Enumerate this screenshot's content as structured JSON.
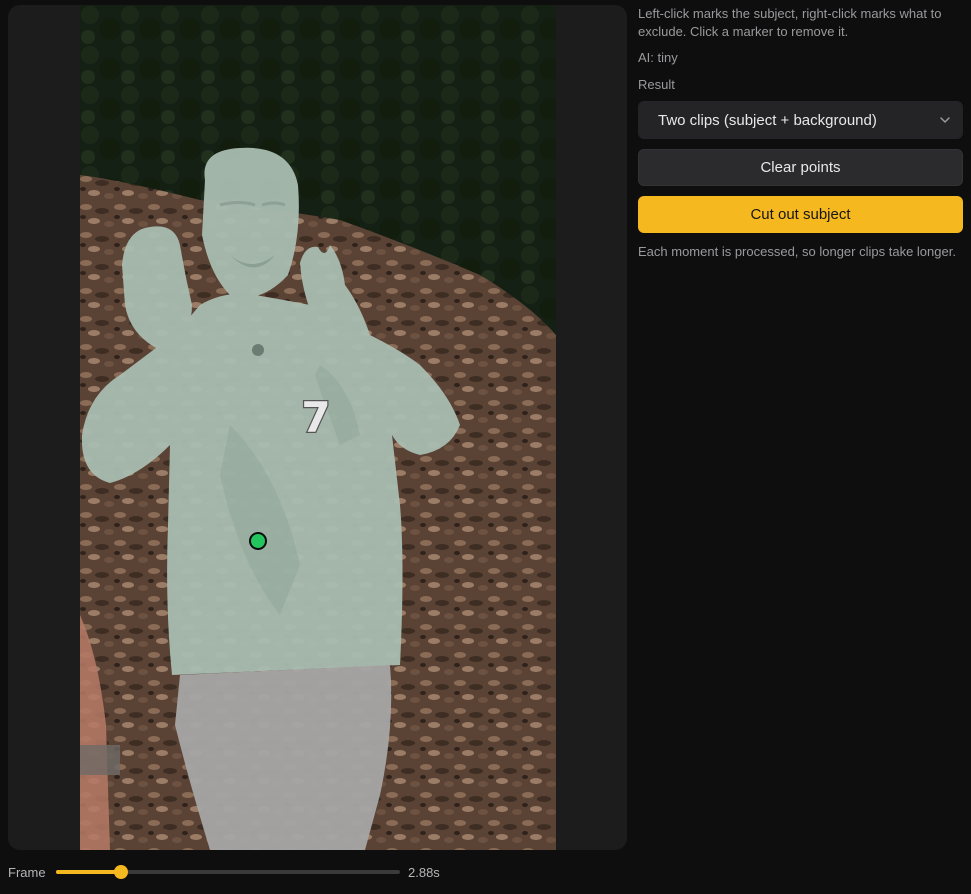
{
  "sidebar": {
    "hint": "Left-click marks the subject, right-click marks what to exclude. Click a marker to remove it.",
    "ai_model": "AI: tiny",
    "result_label": "Result",
    "result_select_value": "Two clips (subject + background)",
    "clear_button": "Clear points",
    "cut_button": "Cut out subject",
    "note": "Each moment is processed, so longer clips take longer."
  },
  "frame": {
    "label": "Frame",
    "time": "2.88s",
    "progress_fraction": 0.19
  },
  "preview": {
    "subject_marker_color": "#22c55e",
    "shirt_number": "7"
  },
  "colors": {
    "accent": "#f6b81f",
    "background": "#0e0e0f",
    "panel": "#1c1c1d"
  }
}
